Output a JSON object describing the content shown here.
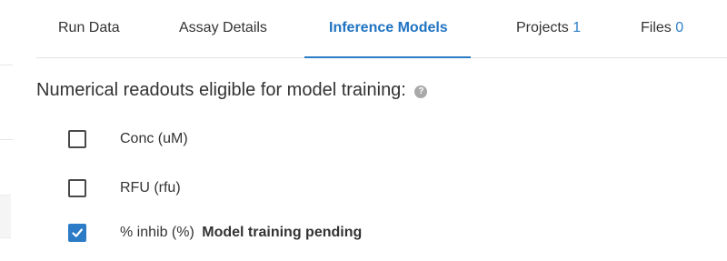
{
  "tabs": [
    {
      "label": "Run Data",
      "count": "",
      "active": false
    },
    {
      "label": "Assay Details",
      "count": "",
      "active": false
    },
    {
      "label": "Inference Models",
      "count": "",
      "active": true
    },
    {
      "label": "Projects",
      "count": "1",
      "active": false
    },
    {
      "label": "Files",
      "count": "0",
      "active": false
    }
  ],
  "section": {
    "heading": "Numerical readouts eligible for model training:",
    "help_icon": "question-icon",
    "help_glyph": "?"
  },
  "readouts": [
    {
      "label": "Conc (uM)",
      "checked": false,
      "status": ""
    },
    {
      "label": "RFU (rfu)",
      "checked": false,
      "status": ""
    },
    {
      "label": "% inhib (%)",
      "checked": true,
      "status": "Model training pending"
    }
  ],
  "colors": {
    "accent": "#2b7bc6",
    "active_tab_text": "#1f73c2",
    "count_text": "#2f80c8",
    "text": "#333333"
  }
}
